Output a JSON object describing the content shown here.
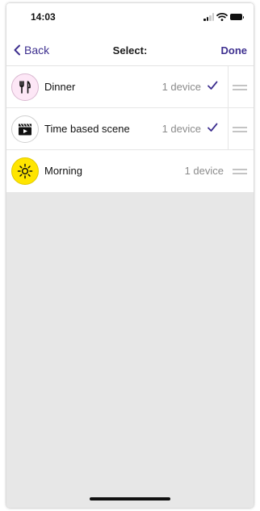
{
  "status": {
    "time": "14:03"
  },
  "nav": {
    "back_label": "Back",
    "title": "Select:",
    "done_label": "Done"
  },
  "colors": {
    "accent": "#3d2f8f",
    "list_bg": "#ffffff",
    "page_bg": "#e7e7e7",
    "morning_icon_bg": "#ffe500",
    "dinner_icon_bg": "#fde7f6"
  },
  "rows": [
    {
      "name": "Dinner",
      "count": "1 device",
      "selected": true,
      "icon": "fork-knife-icon"
    },
    {
      "name": "Time based scene",
      "count": "1 device",
      "selected": true,
      "icon": "clapperboard-icon"
    },
    {
      "name": "Morning",
      "count": "1 device",
      "selected": false,
      "icon": "sun-icon"
    }
  ]
}
